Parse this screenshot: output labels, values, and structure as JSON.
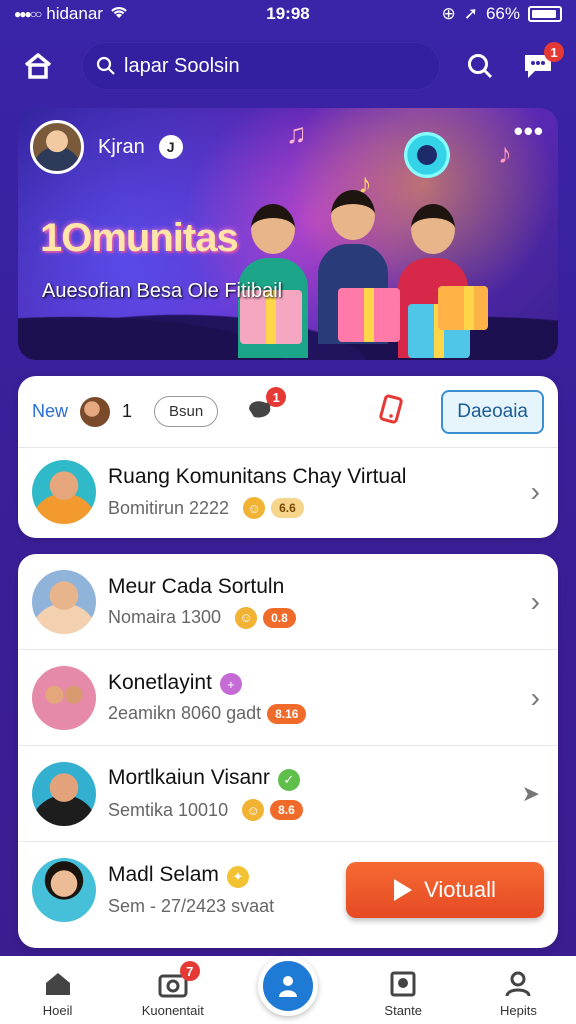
{
  "status_bar": {
    "carrier": "hidanar",
    "time": "19:98",
    "battery": "66%"
  },
  "header": {
    "search_placeholder": "lapar Soolsin",
    "notification_count": "1"
  },
  "hero": {
    "username": "Kjran",
    "verified_mark": "J",
    "title": "1Omunitas",
    "subtitle": "Auesofian Besa Ole Fitibail"
  },
  "featured": {
    "new_label": "New",
    "count": "1",
    "pill": "Bsun",
    "badge": "1",
    "button": "Daeoaia",
    "item": {
      "title": "Ruang Komunitans Chay Virtual",
      "subtitle": "Bomitirun 2222",
      "tag": "6.6"
    }
  },
  "list": [
    {
      "title": "Meur Cada Sortuln",
      "subtitle": "Nomaira 1300",
      "tag": "0.8",
      "tag_color": "#f06a2a"
    },
    {
      "title": "Konetlayint",
      "subtitle": "2eamikn 8060  gadt",
      "tag": "8.16",
      "tag_color": "#f06a2a"
    },
    {
      "title": "Mortlkaiun Visanr",
      "subtitle": "Semtika 10010",
      "tag": "8.6",
      "tag_color": "#f06a2a"
    },
    {
      "title": "Madl Selam",
      "subtitle": "Sem - 27/2423 svaat",
      "tag": "",
      "tag_color": ""
    }
  ],
  "play_button": "Viotuall",
  "bottom_nav": {
    "home": "Hoeil",
    "community": "Kuonentait",
    "community_badge": "7",
    "stats": "Stante",
    "profile": "Hepits"
  },
  "colors": {
    "accent": "#3a24a8",
    "orange": "#f06a2a",
    "blue": "#1f7ad6"
  }
}
